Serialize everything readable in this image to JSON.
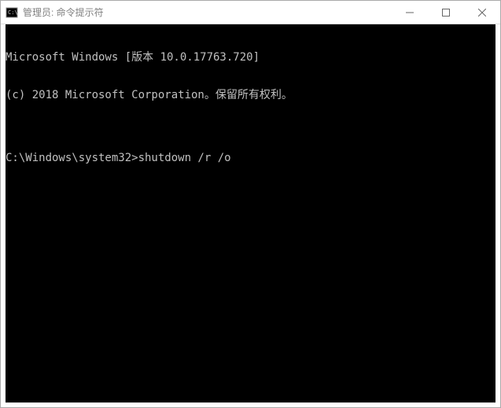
{
  "window": {
    "title": "管理员: 命令提示符"
  },
  "console": {
    "line1": "Microsoft Windows [版本 10.0.17763.720]",
    "line2": "(c) 2018 Microsoft Corporation。保留所有权利。",
    "blank": "",
    "prompt": "C:\\Windows\\system32>",
    "command": "shutdown /r /o"
  }
}
